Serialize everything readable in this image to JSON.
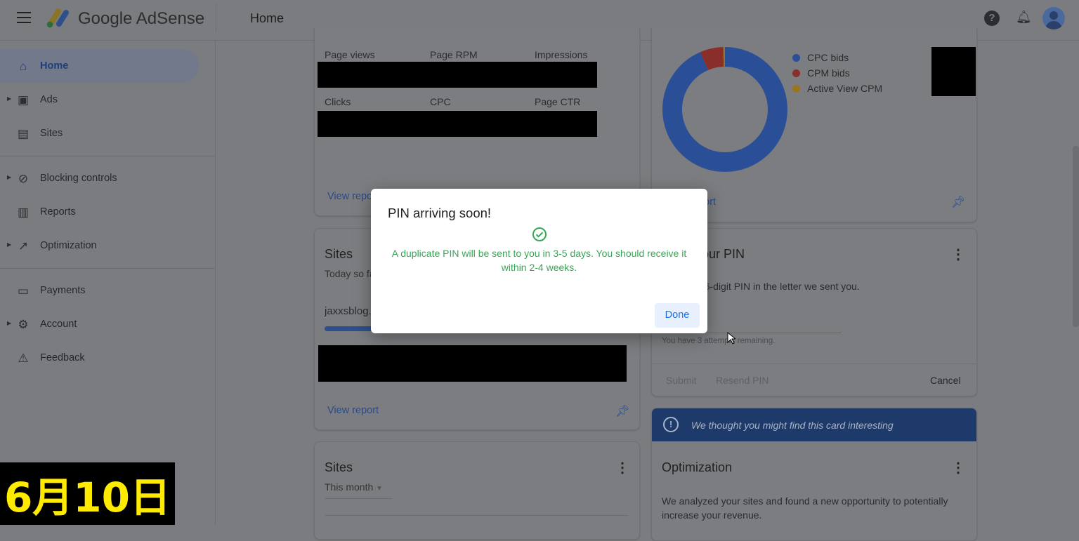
{
  "header": {
    "brand": "Google AdSense",
    "page_title": "Home"
  },
  "sidebar": {
    "items": [
      {
        "label": "Home",
        "icon": "home-icon",
        "active": true
      },
      {
        "label": "Ads",
        "icon": "ads-icon",
        "expandable": true
      },
      {
        "label": "Sites",
        "icon": "sites-icon"
      },
      {
        "label": "Blocking controls",
        "icon": "block-icon",
        "expandable": true
      },
      {
        "label": "Reports",
        "icon": "bar-chart-icon"
      },
      {
        "label": "Optimization",
        "icon": "trending-icon",
        "expandable": true
      },
      {
        "label": "Payments",
        "icon": "payments-icon"
      },
      {
        "label": "Account",
        "icon": "gear-icon",
        "expandable": true
      },
      {
        "label": "Feedback",
        "icon": "feedback-icon"
      }
    ]
  },
  "performance_card": {
    "metrics_row1": [
      "Page views",
      "Page RPM",
      "Impressions"
    ],
    "metrics_row2": [
      "Clicks",
      "CPC",
      "Page CTR"
    ],
    "view_report": "View report"
  },
  "sites_card": {
    "title": "Sites",
    "period": "Today so far",
    "site": "jaxxsblog.",
    "view_report": "View report"
  },
  "sites_card2": {
    "title": "Sites",
    "period": "This month"
  },
  "bids_card": {
    "legend": [
      "CPC bids",
      "CPM bids",
      "Active View CPM"
    ],
    "colors": [
      "#2a4f96",
      "#8a2e2a",
      "#9a7420"
    ],
    "shares_percent": [
      93.5,
      6,
      0.5
    ],
    "view_report": "View report"
  },
  "pin_card": {
    "title": "Enter your PIN",
    "instruction": "Enter the 6-digit PIN in the letter we sent you.",
    "attempts": "You have 3 attempts remaining.",
    "submit": "Submit",
    "resend": "Resend PIN",
    "cancel": "Cancel"
  },
  "interesting_banner": {
    "text": "We thought you might find this card interesting"
  },
  "optimization_card": {
    "title": "Optimization",
    "body": "We analyzed your sites and found a new opportunity to potentially increase your revenue."
  },
  "modal": {
    "title": "PIN arriving soon!",
    "message": "A duplicate PIN will be sent to you in 3-5 days. You should receive it within 2-4 weeks.",
    "done": "Done",
    "accent": "#34a853"
  },
  "overlay_date": "6月10日"
}
